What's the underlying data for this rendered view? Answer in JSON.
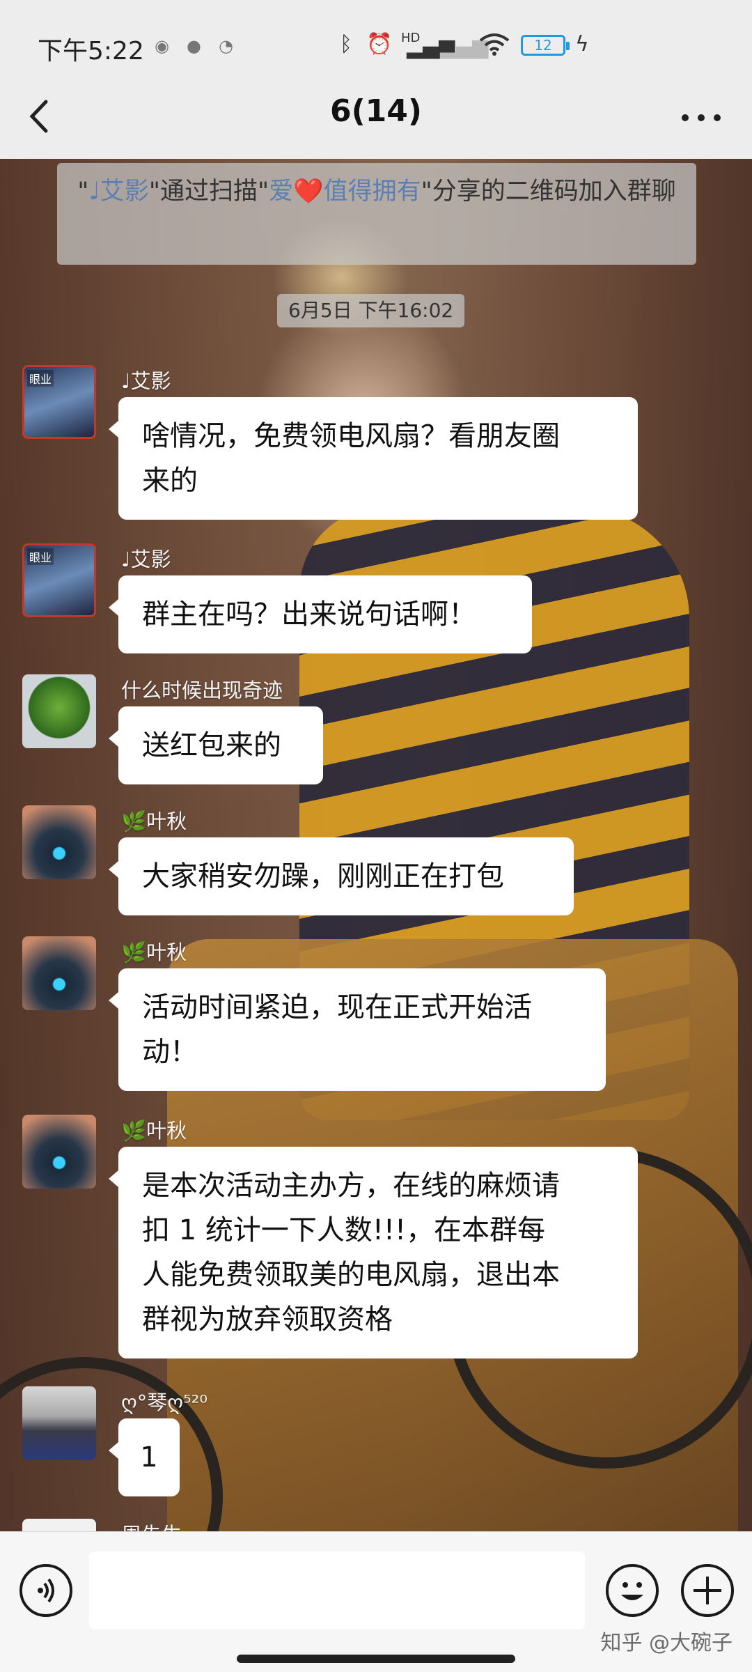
{
  "status_bar": {
    "time": "下午5:22",
    "battery": "12",
    "icons": [
      "bluetooth-icon",
      "alarm-icon",
      "hd-signal-icon",
      "signal-icon",
      "wifi-icon",
      "battery-icon",
      "charging-icon"
    ],
    "hd_label": "HD"
  },
  "nav": {
    "title": "6(14)"
  },
  "system_message": {
    "quote_open": "\"",
    "inviter": "♩艾影",
    "text1": "\"通过扫描\"",
    "sharer": "爱❤️值得拥有",
    "text2": "\"分享的二维码加入群聊"
  },
  "timestamp": "6月5日 下午16:02",
  "avatar_tag": "眼业",
  "messages": [
    {
      "nick": "♩艾影",
      "text": "啥情况，免费领电风扇？看朋友圈来的",
      "lines": [
        "啥情况，免费领电风扇？看朋友圈",
        "来的"
      ]
    },
    {
      "nick": "♩艾影",
      "text": "群主在吗？出来说句话啊！",
      "lines": [
        "群主在吗？出来说句话啊！"
      ]
    },
    {
      "nick": "什么时候出现奇迹",
      "text": "送红包来的",
      "lines": [
        "送红包来的"
      ]
    },
    {
      "nick": "🌿叶秋",
      "text": "大家稍安勿躁，刚刚正在打包",
      "lines": [
        "大家稍安勿躁，刚刚正在打包"
      ]
    },
    {
      "nick": "🌿叶秋",
      "text": "活动时间紧迫，现在正式开始活动！",
      "lines": [
        "活动时间紧迫，现在正式开始活",
        "动！"
      ]
    },
    {
      "nick": "🌿叶秋",
      "text": "是本次活动主办方，在线的麻烦请扣 1 统计一下人数!!!，在本群每人能免费领取美的电风扇，退出本群视为放弃领取资格",
      "lines": [
        "是本次活动主办方，在线的麻烦请",
        "扣 1 统计一下人数!!!，在本群每",
        "人能免费领取美的电风扇，退出本",
        "群视为放弃领取资格"
      ]
    },
    {
      "nick": "ღ°琴ღ⁵²⁰",
      "text": "1",
      "lines": [
        "1"
      ]
    },
    {
      "nick": "周先生",
      "text": "",
      "lines": []
    }
  ],
  "input_bar": {
    "placeholder": "",
    "watermark": "知乎 @大碗子"
  }
}
